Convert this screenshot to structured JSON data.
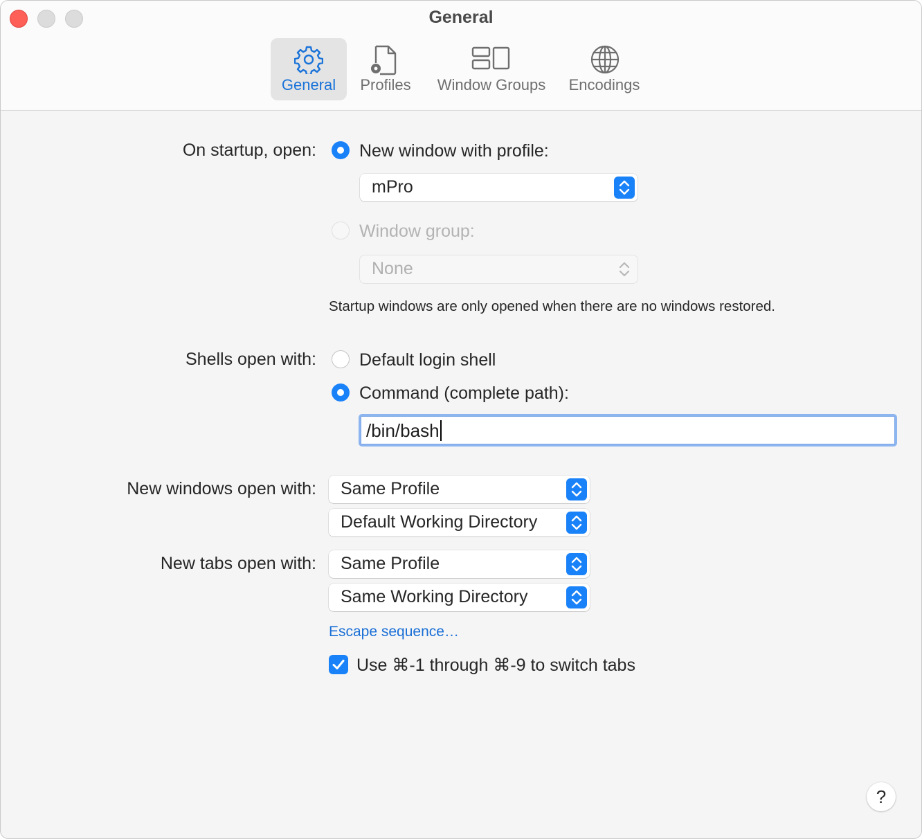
{
  "window": {
    "title": "General"
  },
  "toolbar": {
    "tabs": [
      {
        "label": "General",
        "icon": "gear-icon"
      },
      {
        "label": "Profiles",
        "icon": "profiles-icon"
      },
      {
        "label": "Window Groups",
        "icon": "window-groups-icon"
      },
      {
        "label": "Encodings",
        "icon": "globe-icon"
      }
    ]
  },
  "startup": {
    "label": "On startup, open:",
    "option_profile": "New window with profile:",
    "profile_value": "mPro",
    "option_group": "Window group:",
    "group_value": "None",
    "note": "Startup windows are only opened when there are no windows restored."
  },
  "shells": {
    "label": "Shells open with:",
    "option_default": "Default login shell",
    "option_command": "Command (complete path):",
    "command_value": "/bin/bash"
  },
  "new_windows": {
    "label": "New windows open with:",
    "profile_value": "Same Profile",
    "directory_value": "Default Working Directory"
  },
  "new_tabs": {
    "label": "New tabs open with:",
    "profile_value": "Same Profile",
    "directory_value": "Same Working Directory"
  },
  "escape_link": "Escape sequence…",
  "switch_tabs": {
    "label": "Use ⌘-1 through ⌘-9 to switch tabs",
    "checked": true
  },
  "help": "?",
  "colors": {
    "accent": "#1a82f8",
    "link": "#1a6fd6",
    "close": "#fe5f57"
  }
}
